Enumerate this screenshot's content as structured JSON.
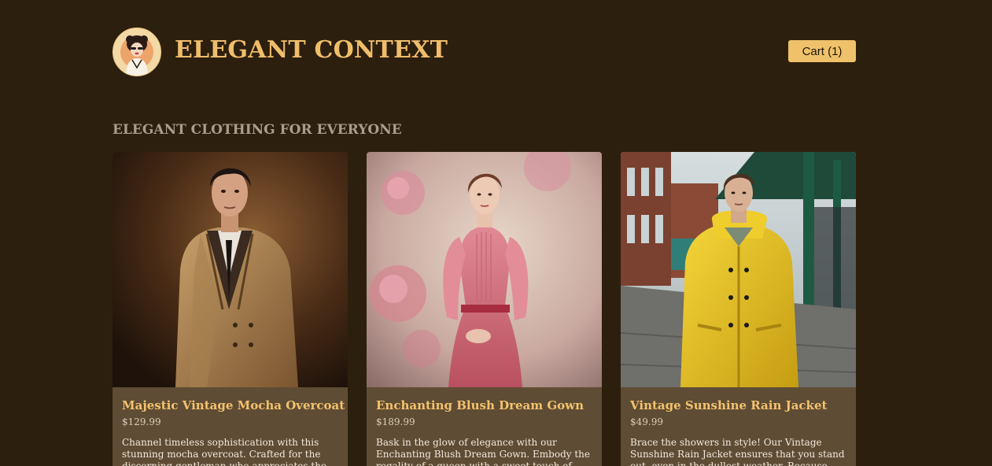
{
  "header": {
    "logo_icon": "vintage-lady-portrait-icon",
    "title": "ELEGANT CONTEXT",
    "cart_label": "Cart (1)"
  },
  "section": {
    "heading": "ELEGANT CLOTHING FOR EVERYONE"
  },
  "products": [
    {
      "name": "Majestic Vintage Mocha Overcoat",
      "price": "$129.99",
      "description": "Channel timeless sophistication with this stunning mocha overcoat. Crafted for the discerning gentleman who appreciates the fine",
      "image_icon": "man-in-mocha-overcoat-photo"
    },
    {
      "name": "Enchanting Blush Dream Gown",
      "price": "$189.99",
      "description": "Bask in the glow of elegance with our Enchanting Blush Dream Gown. Embody the regality of a queen with a sweet touch of pink",
      "image_icon": "woman-in-pink-gown-photo"
    },
    {
      "name": "Vintage Sunshine Rain Jacket",
      "price": "$49.99",
      "description": "Brace the showers in style! Our Vintage Sunshine Rain Jacket ensures that you stand out, even in the dullest weather. Because rain is",
      "image_icon": "man-in-yellow-rain-jacket-photo"
    }
  ],
  "colors": {
    "background": "#2d1f0e",
    "accent": "#efbe6b",
    "card_background": "#5f4c34"
  }
}
